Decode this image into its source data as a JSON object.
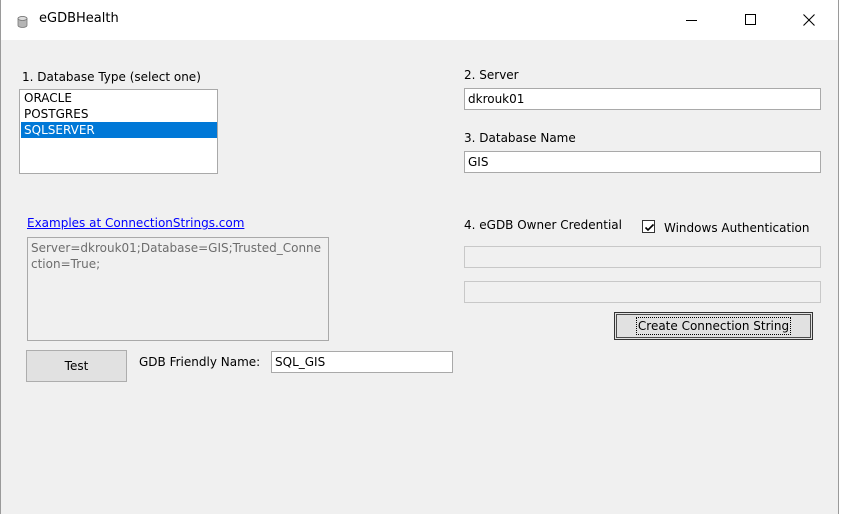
{
  "window": {
    "title": "eGDBHealth",
    "app_icon": "database-icon",
    "controls": {
      "minimize": "minimize-icon",
      "maximize": "maximize-icon",
      "close": "close-icon"
    }
  },
  "db_type": {
    "label": "1. Database Type (select one)",
    "options": [
      "ORACLE",
      "POSTGRES",
      "SQLSERVER"
    ],
    "selected": "SQLSERVER"
  },
  "server": {
    "label": "2. Server",
    "value": "dkrouk01"
  },
  "database": {
    "label": "3. Database Name",
    "value": "GIS"
  },
  "link": {
    "text": "Examples at ConnectionStrings.com"
  },
  "connection_string": {
    "value": "Server=dkrouk01;Database=GIS;Trusted_Connection=True;"
  },
  "credential": {
    "label": "4. eGDB Owner Credential",
    "windows_auth_label": "Windows Authentication",
    "windows_auth_checked": true,
    "username_value": "",
    "password_value": ""
  },
  "buttons": {
    "create": "Create Connection String",
    "test": "Test"
  },
  "friendly_name": {
    "label": "GDB Friendly Name:",
    "value": "SQL_GIS"
  },
  "colors": {
    "selection": "#0078d7",
    "link": "#0000ff",
    "client_bg": "#f0f0f0"
  }
}
